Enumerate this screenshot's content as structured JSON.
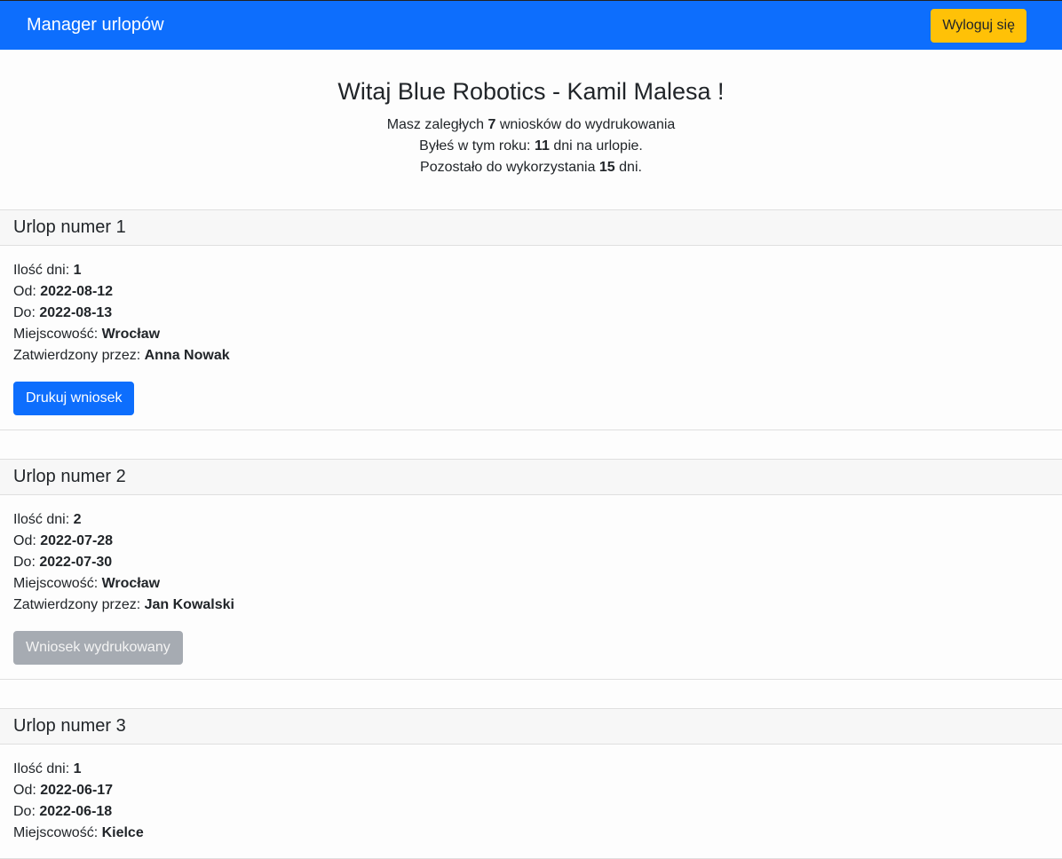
{
  "navbar": {
    "brand": "Manager urlopów",
    "logout_label": "Wyloguj się"
  },
  "welcome": {
    "title": "Witaj Blue Robotics - Kamil Malesa !",
    "pending_prefix": "Masz zaległych ",
    "pending_count": "7",
    "pending_suffix": " wniosków do wydrukowania",
    "used_prefix": "Byłeś w tym roku: ",
    "used_days": "11",
    "used_suffix": " dni na urlopie.",
    "remaining_prefix": "Pozostało do wykorzystania ",
    "remaining_days": "15",
    "remaining_suffix": " dni."
  },
  "labels": {
    "days": "Ilość dni: ",
    "from": "Od: ",
    "to": "Do: ",
    "city": "Miejscowość: ",
    "approved_by": "Zatwierdzony przez: "
  },
  "leaves": [
    {
      "title": "Urlop numer 1",
      "days": "1",
      "from": "2022-08-12",
      "to": "2022-08-13",
      "city": "Wrocław",
      "approved_by": "Anna Nowak",
      "button_label": "Drukuj wniosek"
    },
    {
      "title": "Urlop numer 2",
      "days": "2",
      "from": "2022-07-28",
      "to": "2022-07-30",
      "city": "Wrocław",
      "approved_by": "Jan Kowalski",
      "button_label": "Wniosek wydrukowany"
    },
    {
      "title": "Urlop numer 3",
      "days": "1",
      "from": "2022-06-17",
      "to": "2022-06-18",
      "city": "Kielce"
    }
  ],
  "colors": {
    "primary": "#0d6efd",
    "warning": "#ffc107",
    "disabled": "#a6abb2"
  }
}
